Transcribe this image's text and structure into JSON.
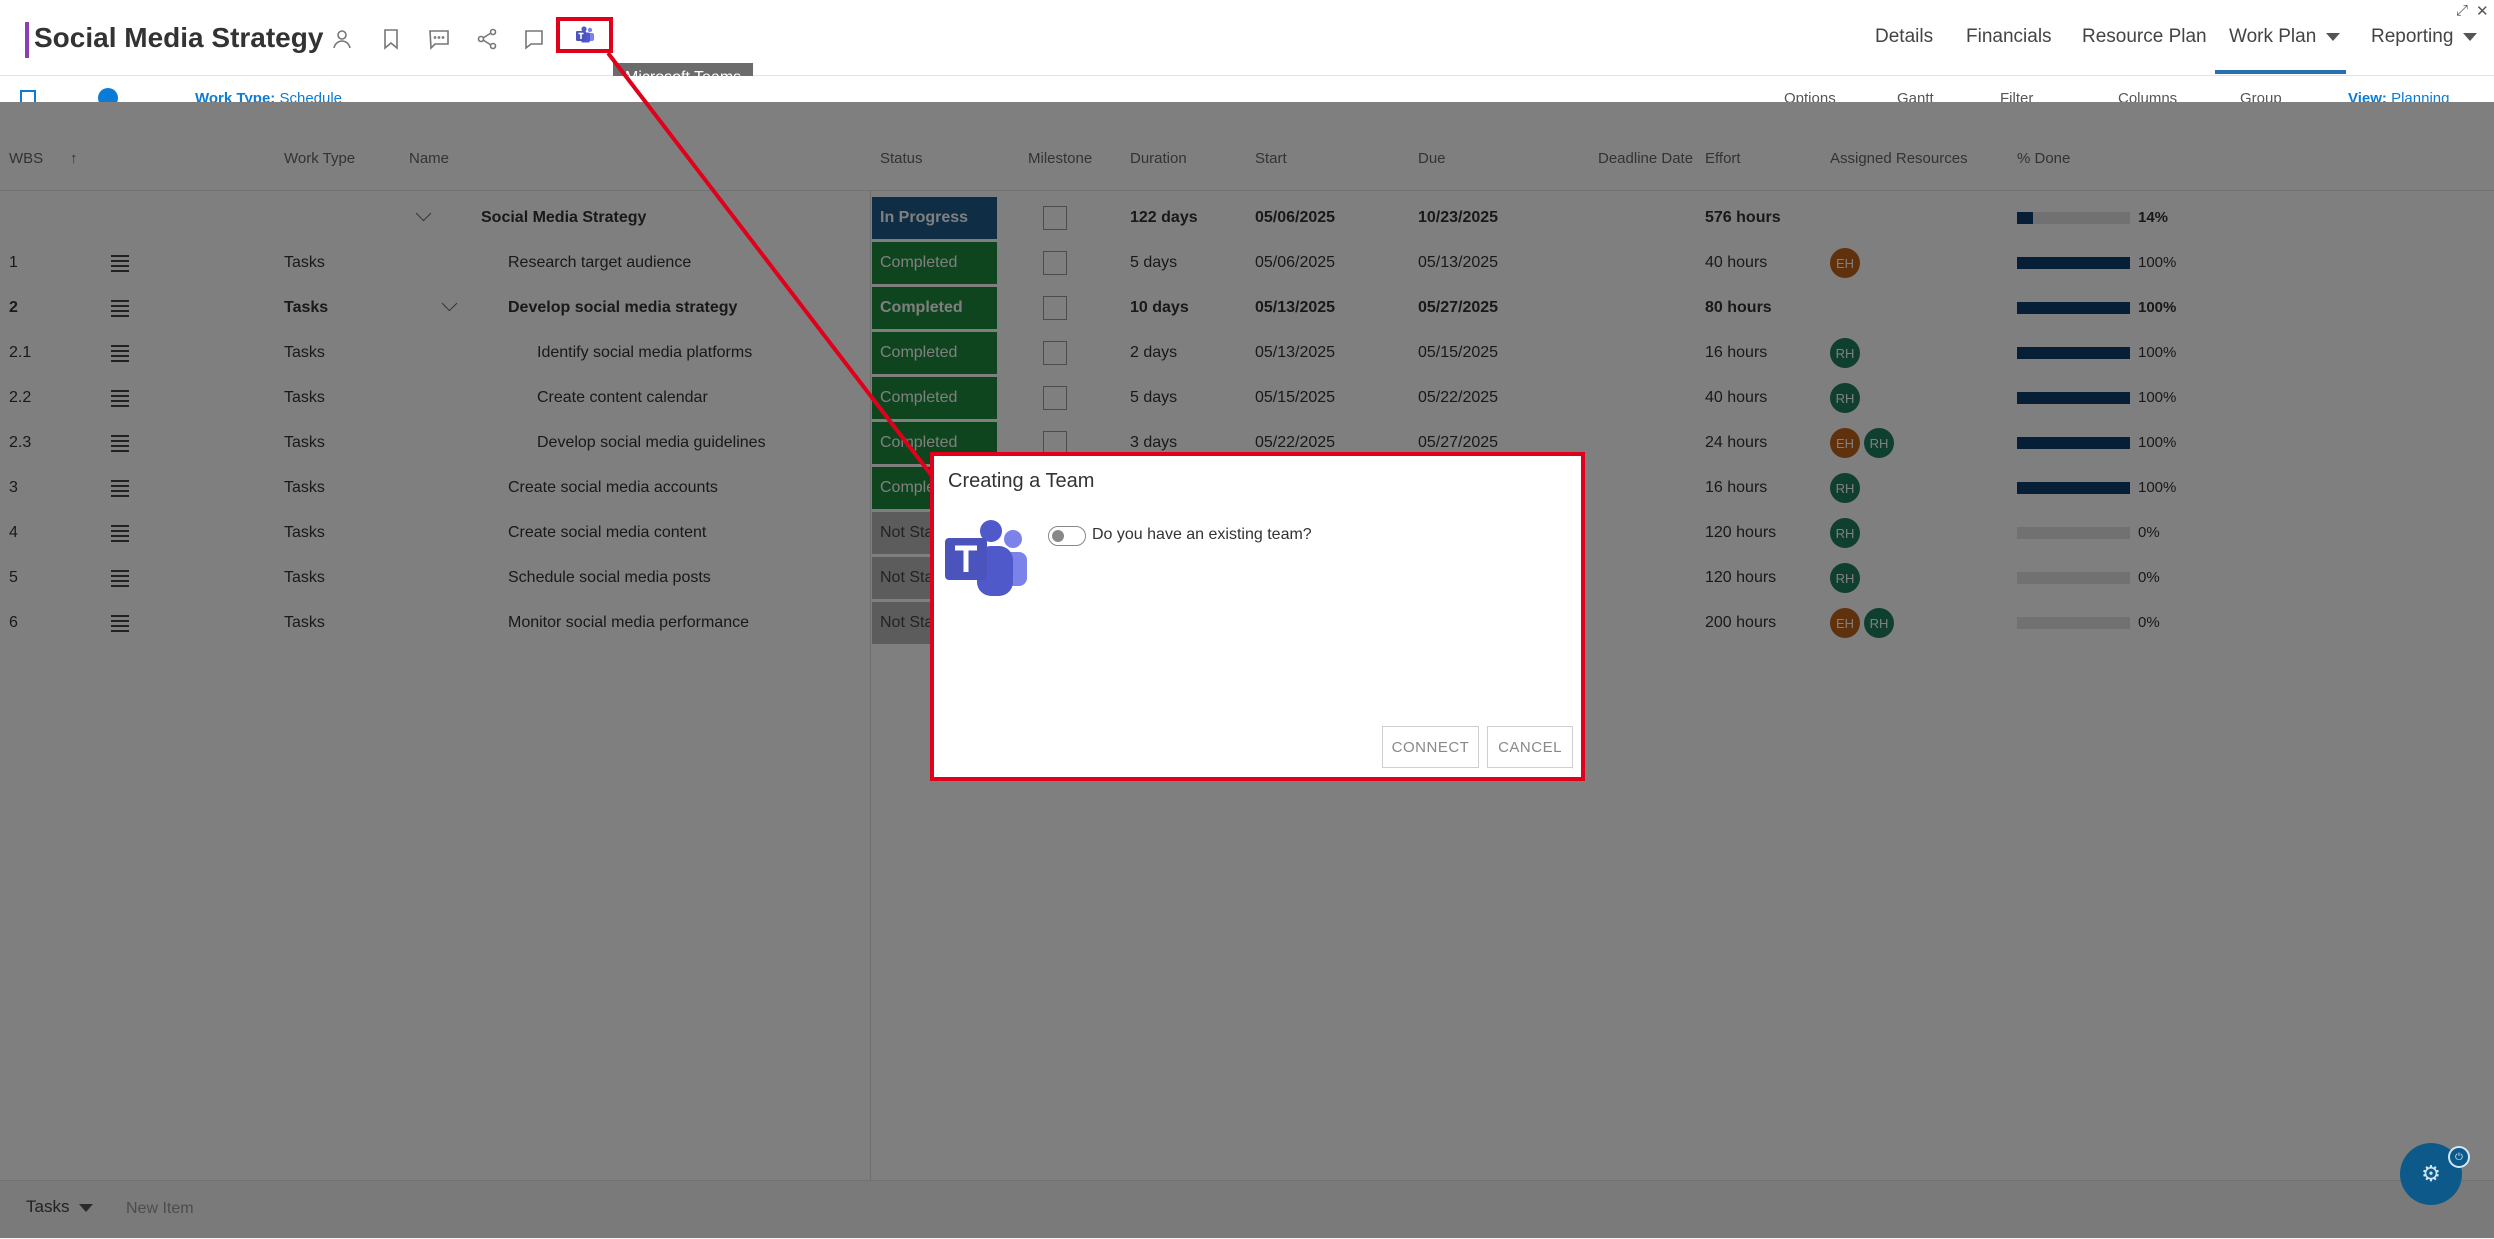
{
  "window": {
    "expand_glyph": "⤢",
    "close_glyph": "✕"
  },
  "header": {
    "title": "Social Media Strategy",
    "tooltip": "Microsoft Teams",
    "nav": [
      "Details",
      "Financials",
      "Resource Plan",
      "Work Plan",
      "Reporting"
    ],
    "active_nav": "Work Plan"
  },
  "toolbar": {
    "work_type_label": "Work Type:",
    "work_type_value": "Schedule",
    "options": "Options",
    "gantt": "Gantt",
    "filter": "Filter",
    "columns": "Columns",
    "group": "Group",
    "view_label": "View:",
    "view_value": "Planning"
  },
  "columns": {
    "wbs": "WBS",
    "sort_arrow": "↑",
    "work_type": "Work Type",
    "name": "Name",
    "status": "Status",
    "milestone": "Milestone",
    "duration": "Duration",
    "start": "Start",
    "due": "Due",
    "deadline": "Deadline Date",
    "effort": "Effort",
    "resources": "Assigned Resources",
    "done": "% Done"
  },
  "rows": [
    {
      "wbs": "",
      "type": "",
      "name": "Social Media Strategy",
      "status": "In Progress",
      "duration": "122 days",
      "start": "05/06/2025",
      "due": "10/23/2025",
      "effort": "576 hours",
      "resources": [],
      "done": "14%",
      "done_frac": 0.14
    },
    {
      "wbs": "1",
      "type": "Tasks",
      "name": "Research target audience",
      "status": "Completed",
      "duration": "5 days",
      "start": "05/06/2025",
      "due": "05/13/2025",
      "effort": "40 hours",
      "resources": [
        "EH"
      ],
      "done": "100%",
      "done_frac": 1
    },
    {
      "wbs": "2",
      "type": "Tasks",
      "name": "Develop social media strategy",
      "status": "Completed",
      "duration": "10 days",
      "start": "05/13/2025",
      "due": "05/27/2025",
      "effort": "80 hours",
      "resources": [],
      "done": "100%",
      "done_frac": 1
    },
    {
      "wbs": "2.1",
      "type": "Tasks",
      "name": "Identify social media platforms",
      "status": "Completed",
      "duration": "2 days",
      "start": "05/13/2025",
      "due": "05/15/2025",
      "effort": "16 hours",
      "resources": [
        "RH"
      ],
      "done": "100%",
      "done_frac": 1
    },
    {
      "wbs": "2.2",
      "type": "Tasks",
      "name": "Create content calendar",
      "status": "Completed",
      "duration": "5 days",
      "start": "05/15/2025",
      "due": "05/22/2025",
      "effort": "40 hours",
      "resources": [
        "RH"
      ],
      "done": "100%",
      "done_frac": 1
    },
    {
      "wbs": "2.3",
      "type": "Tasks",
      "name": "Develop social media guidelines",
      "status": "Completed",
      "duration": "3 days",
      "start": "05/22/2025",
      "due": "05/27/2025",
      "effort": "24 hours",
      "resources": [
        "EH",
        "RH"
      ],
      "done": "100%",
      "done_frac": 1
    },
    {
      "wbs": "3",
      "type": "Tasks",
      "name": "Create social media accounts",
      "status": "Completed",
      "duration": "",
      "start": "",
      "due": "",
      "effort": "16 hours",
      "resources": [
        "RH"
      ],
      "done": "100%",
      "done_frac": 1
    },
    {
      "wbs": "4",
      "type": "Tasks",
      "name": "Create social media content",
      "status": "Not Started",
      "duration": "",
      "start": "",
      "due": "",
      "effort": "120 hours",
      "resources": [
        "RH"
      ],
      "done": "0%",
      "done_frac": 0
    },
    {
      "wbs": "5",
      "type": "Tasks",
      "name": "Schedule social media posts",
      "status": "Not Started",
      "duration": "",
      "start": "",
      "due": "",
      "effort": "120 hours",
      "resources": [
        "RH"
      ],
      "done": "0%",
      "done_frac": 0
    },
    {
      "wbs": "6",
      "type": "Tasks",
      "name": "Monitor social media performance",
      "status": "Not Started",
      "duration": "",
      "start": "",
      "due": "",
      "effort": "200 hours",
      "resources": [
        "EH",
        "RH"
      ],
      "done": "0%",
      "done_frac": 0
    }
  ],
  "footer": {
    "tasks": "Tasks",
    "new_item": "New Item"
  },
  "dialog": {
    "title": "Creating a Team",
    "toggle_label": "Do you have an existing team?",
    "toggle_on": false,
    "connect": "CONNECT",
    "cancel": "CANCEL"
  },
  "colors": {
    "accent": "#8a3fb7",
    "highlight": "#e0001b",
    "in_progress": "#1f5d8c",
    "completed": "#1c8a3c",
    "progress_fill": "#0d3f6e"
  }
}
